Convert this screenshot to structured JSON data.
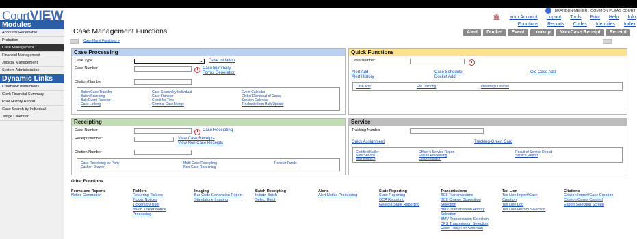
{
  "app": {
    "logo_light": "Court",
    "logo_bold": "VIEW"
  },
  "user": {
    "name": "BRANDEN MEYER",
    "separator": ":",
    "org": "COMMON PLEAS COURT"
  },
  "topnav": [
    "Your Account",
    "Logout",
    "Tools",
    "Print",
    "Help",
    "Info"
  ],
  "subnav": [
    "Functions",
    "Reports",
    "Codes",
    "Identities",
    "Index"
  ],
  "sidebar": {
    "modules_title": "Modules",
    "modules": [
      "Accounts Receivable",
      "Probation",
      "Case Management",
      "Financial Management",
      "Judicial Management",
      "System Administration"
    ],
    "links_title": "Dynamic Links",
    "links": [
      "Courtview Instructions",
      "Clerk Financial Summary",
      "Prior History Report",
      "Case Search by Individual",
      "Judge Calendar"
    ]
  },
  "page": {
    "title": "Case Management Functions",
    "breadcrumb": "Case Mgmt Functions »"
  },
  "actions": [
    "Alert",
    "Docket",
    "Event",
    "Lookup",
    "Non-Case Receipt",
    "Receipt"
  ],
  "case_processing": {
    "title": "Case Processing",
    "case_type_label": "Case Type",
    "case_initiation": "Case Initiation",
    "case_number_label": "Case Number",
    "case_summary": "Case Summary",
    "forms_generation": "Forms Generation",
    "citation_label": "Citation Number",
    "links": [
      [
        "Batch Case Transfer",
        "Batch Scanning",
        "Bulk Event Transfer",
        "Case Linking"
      ],
      [
        "Case Search by Individual",
        "Case Transfer",
        "Credit for Time",
        "Criminal Case Merge"
      ],
      [
        "Event Calendar",
        "Global Dismissal of Costs",
        "Session Calendar",
        "Trackable Item Bulk Update"
      ]
    ]
  },
  "quick_functions": {
    "title": "Quick Functions",
    "case_number_label": "Case Number",
    "alert_add": "Alert Add",
    "alert_history": "Alert History",
    "case_schedule": "Case Schedule",
    "docket_add": "Docket Add",
    "old_case_add": "Old Case Add",
    "links": [
      "Case Add",
      "File Tracking",
      "eMarriage License"
    ]
  },
  "receipting": {
    "title": "Receipting",
    "case_number_label": "Case Number",
    "case_receipting": "Case Receipting",
    "receipt_number_label": "Receipt Number:",
    "view_case_receipts": "View Case Receipts",
    "view_non_case_receipts": "View Non Case Receipts",
    "citation_label": "Citation Number",
    "links": [
      [
        "Case Receipting by Party",
        "Cashier Drawer"
      ],
      [
        "Multi-Case Receipting",
        "Non-Case Receipting"
      ],
      [
        "Transfer Funds"
      ]
    ]
  },
  "service": {
    "title": "Service",
    "tracking_label": "Tracking Number",
    "quick_assignment": "Quick Assignment",
    "tracking_green_card": "Tracking-Green Card",
    "links": [
      [
        "Certified Mailer",
        "New Service",
        "Maintenance"
      ],
      [
        "Officer's Service Report",
        "Failure Processing",
        "Quick Initiation"
      ],
      [
        "Result of Service Report",
        "Service Report"
      ]
    ]
  },
  "other_functions": {
    "title": "Other Functions",
    "columns": [
      {
        "h": "Forms and Reports",
        "items": [
          "Notice Generation"
        ]
      },
      {
        "h": "Ticklers",
        "items": [
          "Recurring Ticklers",
          "Tickler Notices",
          "Ticklers by User",
          "Batch Tickler Notice",
          "Processing"
        ]
      },
      {
        "h": "Imaging",
        "items": [
          "Bar Code Generation Report",
          "Standalone Imaging"
        ]
      },
      {
        "h": "Batch Receipting",
        "items": [
          "Initiate Batch",
          "Select Batch"
        ]
      },
      {
        "h": "Alerts",
        "items": [
          "Alert Notice Processing"
        ]
      },
      {
        "h": "State Reporting",
        "items": [
          "State Reporting",
          "OCA Reporting",
          "Georgia State Reporting"
        ]
      },
      {
        "h": "Transmissions",
        "items": [
          "BCII Transmissions",
          "BCII Charge Disposition",
          "Selection",
          "BMV Transmission History",
          "Selection",
          "BMV Transmission Selection",
          "DPS Transmission Selection",
          "Event Daily List Selection"
        ]
      },
      {
        "h": "Tax Lien",
        "items": [
          "Tax Lien Import/Case",
          "Creation",
          "Tax Lien Log",
          "Tax Lien History Selection"
        ]
      },
      {
        "h": "Citations",
        "items": [
          "Citation Import/Case Creation",
          "Citation Cases Created",
          "Export Selection Screen"
        ]
      }
    ]
  }
}
